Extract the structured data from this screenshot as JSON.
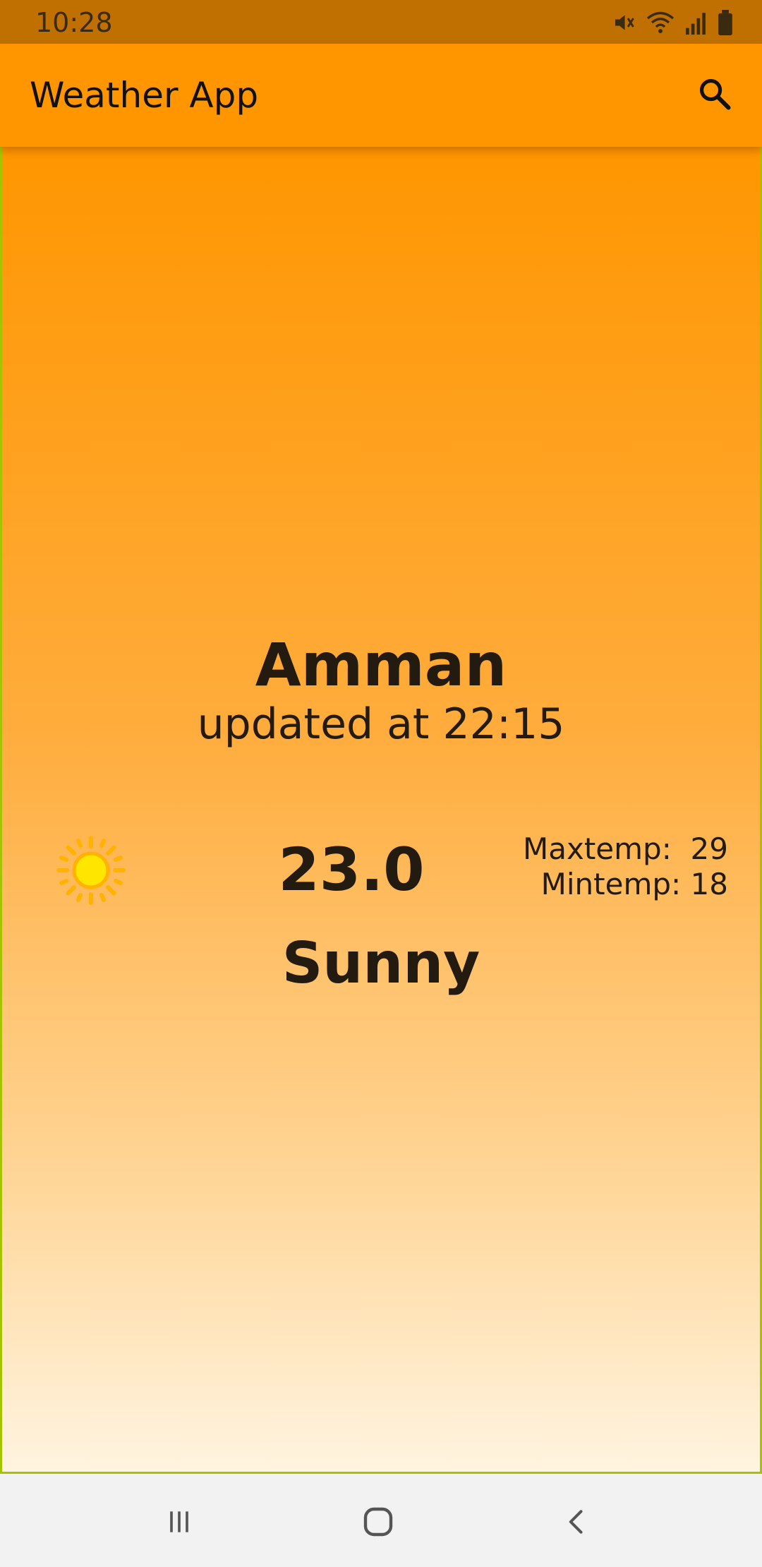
{
  "status_bar": {
    "time": "10:28",
    "icons": [
      "mute-icon",
      "wifi-icon",
      "signal-icon",
      "battery-icon"
    ]
  },
  "app_bar": {
    "title": "Weather App",
    "search_icon": "search-icon"
  },
  "weather": {
    "city": "Amman",
    "updated": "updated at 22:15",
    "icon": "sun-icon",
    "temperature": "23.0",
    "max_temp": "Maxtemp:  29",
    "min_temp": "Mintemp: 18",
    "condition": "Sunny"
  },
  "nav_bar": {
    "buttons": [
      "recent-apps-icon",
      "home-icon",
      "back-icon"
    ]
  },
  "colors": {
    "status_bar": "#bf7000",
    "app_bar": "#ff9600",
    "gradient_top": "#ff9600",
    "gradient_bottom": "#fff4e0",
    "text": "#231a10"
  }
}
